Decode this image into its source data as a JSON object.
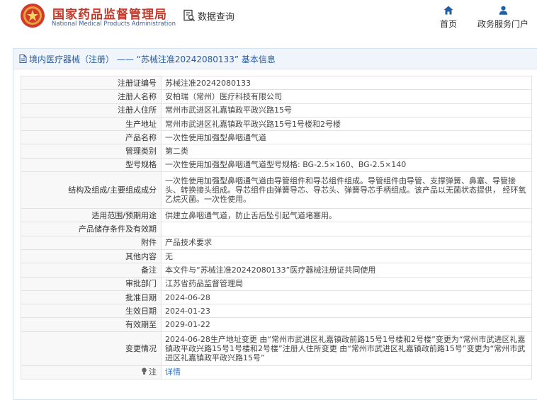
{
  "header": {
    "site_name_cn": "国家药品监督管理局",
    "site_name_en": "National Medical Products Administration",
    "data_query_label": "数据查询",
    "nav": [
      {
        "label": "首页",
        "icon": "home-icon"
      },
      {
        "label": "政务服务门户",
        "icon": "user-icon"
      }
    ]
  },
  "panel": {
    "title": "境内医疗器械（注册） —— “苏械注准20242080133” 基本信息"
  },
  "record": [
    {
      "key": "注册证编号",
      "value": "苏械注准20242080133"
    },
    {
      "key": "注册人名称",
      "value": "安柏瑞（常州）医疗科技有限公司"
    },
    {
      "key": "注册人住所",
      "value": "常州市武进区礼嘉镇政平政兴路15号"
    },
    {
      "key": "生产地址",
      "value": "常州市武进区礼嘉镇政平政兴路15号1号楼和2号楼"
    },
    {
      "key": "产品名称",
      "value": "一次性使用加强型鼻咽通气道"
    },
    {
      "key": "管理类别",
      "value": "第二类"
    },
    {
      "key": "型号规格",
      "value": "一次性使用加强型鼻咽通气道型号规格: BG-2.5×160、BG-2.5×140"
    },
    {
      "key": "结构及组成/主要组成成分",
      "value": "一次性使用加强型鼻咽通气道由导管组件和导芯组件组成。导管组件由导管、支撑弹簧、鼻塞、导管接头、转换接头组成。导芯组件由弹簧导芯、导芯头、弹簧导芯手柄组成。该产品以无菌状态提供， 经环氧乙烷灭菌。一次性使用。"
    },
    {
      "key": "适用范围/预期用途",
      "value": "供建立鼻咽通气道，防止舌后坠引起气道堵塞用。"
    },
    {
      "key": "产品储存条件及有效期",
      "value": ""
    },
    {
      "key": "附件",
      "value": "产品技术要求"
    },
    {
      "key": "其他内容",
      "value": "无"
    },
    {
      "key": "备注",
      "value": "本文件与“苏械注准20242080133”医疗器械注册证共同使用"
    },
    {
      "key": "审批部门",
      "value": "江苏省药品监督管理局"
    },
    {
      "key": "批准日期",
      "value": "2024-06-28"
    },
    {
      "key": "生效日期",
      "value": "2024-01-23"
    },
    {
      "key": "有效期至",
      "value": "2029-01-22"
    },
    {
      "key": "变更情况",
      "value": "2024-06-28生产地址变更 由“常州市武进区礼嘉镇政前路15号1号楼和2号楼”变更为“常州市武进区礼嘉镇政平政兴路15号1号楼和2号楼”注册人住所变更 由“常州市武进区礼嘉镇政前路15号”变更为“常州市武进区礼嘉镇政平政兴路15号”"
    }
  ],
  "note": {
    "key": "注",
    "icon": "lightbulb-icon",
    "link_label": "详情"
  },
  "colors": {
    "brand_red": "#c0392b",
    "link_blue": "#2f6fbf",
    "header_bg": "#f0f5fb"
  }
}
